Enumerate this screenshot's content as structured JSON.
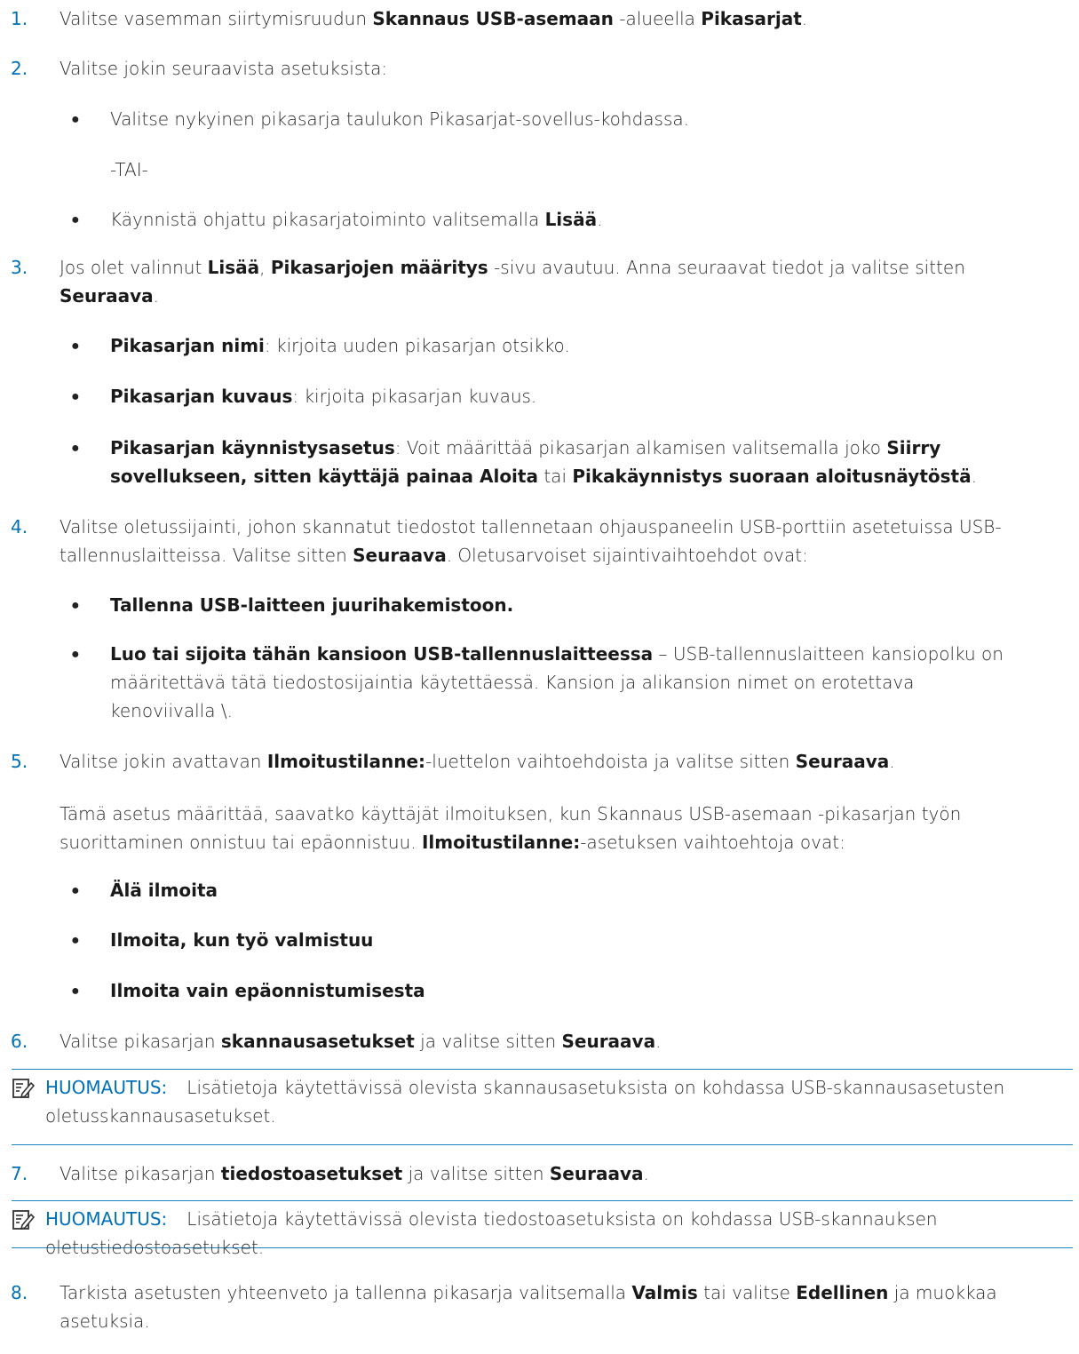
{
  "steps": [
    {
      "num": "1.",
      "parts": [
        {
          "t": "Valitse vasemman siirtymisruudun "
        },
        {
          "t": "Skannaus USB-asemaan",
          "b": true
        },
        {
          "t": " -alueella "
        },
        {
          "t": "Pikasarjat",
          "b": true
        },
        {
          "t": "."
        }
      ]
    },
    {
      "num": "2.",
      "parts": [
        {
          "t": "Valitse jokin seuraavista asetuksista:"
        }
      ]
    },
    {
      "num": "3.",
      "parts": [
        {
          "t": "Jos olet valinnut "
        },
        {
          "t": "Lisää",
          "b": true
        },
        {
          "t": ", "
        },
        {
          "t": "Pikasarjojen määritys",
          "b": true
        },
        {
          "t": " -sivu avautuu. Anna seuraavat tiedot ja valitse sitten "
        },
        {
          "t": "Seuraava",
          "b": true
        },
        {
          "t": "."
        }
      ]
    },
    {
      "num": "4.",
      "parts": [
        {
          "t": "Valitse oletussijainti, johon skannatut tiedostot tallennetaan ohjauspaneelin USB-porttiin asetetuissa USB-tallennuslaitteissa. Valitse sitten "
        },
        {
          "t": "Seuraava",
          "b": true
        },
        {
          "t": ". Oletusarvoiset sijaintivaihtoehdot ovat:"
        }
      ]
    },
    {
      "num": "5.",
      "parts": [
        {
          "t": "Valitse jokin avattavan "
        },
        {
          "t": "Ilmoitustilanne:",
          "b": true
        },
        {
          "t": "-luettelon vaihtoehdoista ja valitse sitten "
        },
        {
          "t": "Seuraava",
          "b": true
        },
        {
          "t": "."
        }
      ]
    },
    {
      "num": "6.",
      "parts": [
        {
          "t": "Valitse pikasarjan "
        },
        {
          "t": "skannausasetukset",
          "b": true
        },
        {
          "t": " ja valitse sitten "
        },
        {
          "t": "Seuraava",
          "b": true
        },
        {
          "t": "."
        }
      ]
    },
    {
      "num": "7.",
      "parts": [
        {
          "t": "Valitse pikasarjan "
        },
        {
          "t": "tiedostoasetukset",
          "b": true
        },
        {
          "t": " ja valitse sitten "
        },
        {
          "t": "Seuraava",
          "b": true
        },
        {
          "t": "."
        }
      ]
    },
    {
      "num": "8.",
      "parts": [
        {
          "t": "Tarkista asetusten yhteenveto ja tallenna pikasarja valitsemalla "
        },
        {
          "t": "Valmis",
          "b": true
        },
        {
          "t": " tai valitse "
        },
        {
          "t": "Edellinen",
          "b": true
        },
        {
          "t": " ja muokkaa asetuksia."
        }
      ]
    }
  ],
  "step2_bullets": [
    {
      "parts": [
        {
          "t": "Valitse nykyinen pikasarja taulukon Pikasarjat-sovellus-kohdassa."
        }
      ]
    },
    {
      "parts": [
        {
          "t": "Käynnistä ohjattu pikasarjatoiminto valitsemalla "
        },
        {
          "t": "Lisää",
          "b": true
        },
        {
          "t": "."
        }
      ]
    }
  ],
  "step2_or": "-TAI-",
  "step3_bullets": [
    {
      "parts": [
        {
          "t": "Pikasarjan nimi",
          "b": true
        },
        {
          "t": ": kirjoita uuden pikasarjan otsikko."
        }
      ]
    },
    {
      "parts": [
        {
          "t": "Pikasarjan kuvaus",
          "b": true
        },
        {
          "t": ": kirjoita pikasarjan kuvaus."
        }
      ]
    },
    {
      "parts": [
        {
          "t": "Pikasarjan käynnistysasetus",
          "b": true
        },
        {
          "t": ": Voit määrittää pikasarjan alkamisen valitsemalla joko "
        },
        {
          "t": "Siirry sovellukseen, sitten käyttäjä painaa Aloita",
          "b": true
        },
        {
          "t": " tai "
        },
        {
          "t": "Pikakäynnistys suoraan aloitusnäytöstä",
          "b": true
        },
        {
          "t": "."
        }
      ]
    }
  ],
  "step4_bullets": [
    {
      "parts": [
        {
          "t": "Tallenna USB-laitteen juurihakemistoon.",
          "b": true
        }
      ]
    },
    {
      "parts": [
        {
          "t": "Luo tai sijoita tähän kansioon USB-tallennuslaitteessa",
          "b": true
        },
        {
          "t": " – USB-tallennuslaitteen kansiopolku on määritettävä tätä tiedostosijaintia käytettäessä. Kansion ja alikansion nimet on erotettava kenoviivalla \\."
        }
      ]
    }
  ],
  "step5_para": [
    {
      "t": "Tämä asetus määrittää, saavatko käyttäjät ilmoituksen, kun Skannaus USB-asemaan -pikasarjan työn suorittaminen onnistuu tai epäonnistuu. "
    },
    {
      "t": "Ilmoitustilanne:",
      "b": true
    },
    {
      "t": "-asetuksen vaihtoehtoja ovat:"
    }
  ],
  "step5_bullets": [
    {
      "parts": [
        {
          "t": "Älä ilmoita",
          "b": true
        }
      ]
    },
    {
      "parts": [
        {
          "t": "Ilmoita, kun työ valmistuu",
          "b": true
        }
      ]
    },
    {
      "parts": [
        {
          "t": "Ilmoita vain epäonnistumisesta",
          "b": true
        }
      ]
    }
  ],
  "bullet_char": "●",
  "notes": [
    {
      "label": "HUOMAUTUS:",
      "text": "Lisätietoja käytettävissä olevista skannausasetuksista on kohdassa USB-skannausasetusten oletusskannausasetukset."
    },
    {
      "label": "HUOMAUTUS:",
      "text": "Lisätietoja käytettävissä olevista tiedostoasetuksista on kohdassa USB-skannauksen oletustiedostoasetukset."
    }
  ],
  "colors": {
    "accent": "#0071b8",
    "rule": "#1c82c1",
    "text": "#2b2b2b"
  },
  "icons": {
    "note": "note-pencil-icon"
  }
}
